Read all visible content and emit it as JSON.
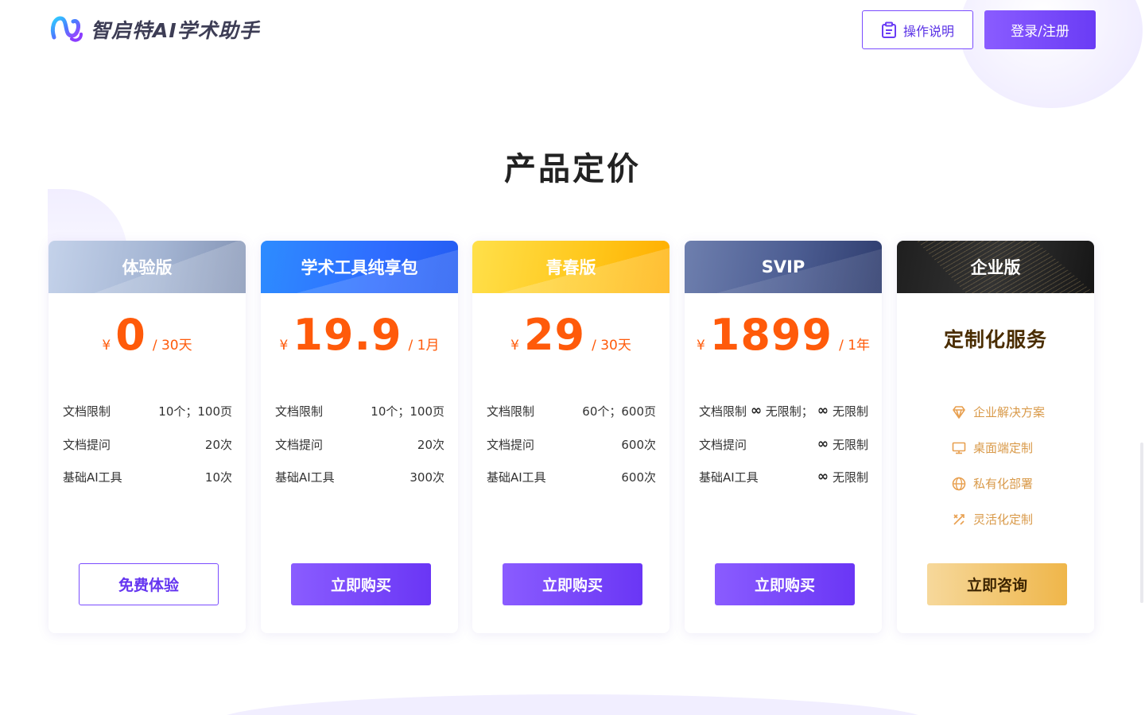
{
  "header": {
    "logo_text": "智启特AI学术助手",
    "guide_label": "操作说明",
    "login_label": "登录/注册"
  },
  "section_title": "产品定价",
  "plans": [
    {
      "name": "体验版",
      "currency": "¥",
      "price": "0",
      "period": "/ 30天",
      "features": [
        {
          "label": "文档限制",
          "value": "10个；100页"
        },
        {
          "label": "文档提问",
          "value": "20次"
        },
        {
          "label": "基础AI工具",
          "value": "10次"
        }
      ],
      "button": "免费体验"
    },
    {
      "name": "学术工具纯享包",
      "currency": "¥",
      "price": "19.9",
      "period": "/ 1月",
      "features": [
        {
          "label": "文档限制",
          "value": "10个；100页"
        },
        {
          "label": "文档提问",
          "value": "20次"
        },
        {
          "label": "基础AI工具",
          "value": "300次"
        }
      ],
      "button": "立即购买"
    },
    {
      "name": "青春版",
      "currency": "¥",
      "price": "29",
      "period": "/ 30天",
      "features": [
        {
          "label": "文档限制",
          "value": "60个；600页"
        },
        {
          "label": "文档提问",
          "value": "600次"
        },
        {
          "label": "基础AI工具",
          "value": "600次"
        }
      ],
      "button": "立即购买"
    },
    {
      "name": "SVIP",
      "currency": "¥",
      "price": "1899",
      "period": "/ 1年",
      "features": [
        {
          "label": "文档限制",
          "value_a": "无限制；",
          "value_b": "无限制"
        },
        {
          "label": "文档提问",
          "value": "无限制"
        },
        {
          "label": "基础AI工具",
          "value": "无限制"
        }
      ],
      "infinity_symbol": "∞",
      "button": "立即购买"
    },
    {
      "name": "企业版",
      "title": "定制化服务",
      "items": [
        {
          "label": "企业解决方案",
          "icon": "diamond-icon"
        },
        {
          "label": "桌面端定制",
          "icon": "monitor-icon"
        },
        {
          "label": "私有化部署",
          "icon": "globe-icon"
        },
        {
          "label": "灵活化定制",
          "icon": "tools-icon"
        }
      ],
      "button": "立即咨询"
    }
  ],
  "colors": {
    "accent": "#7a4cff",
    "price": "#ff5a0a",
    "gold_text": "#d99a4a"
  }
}
